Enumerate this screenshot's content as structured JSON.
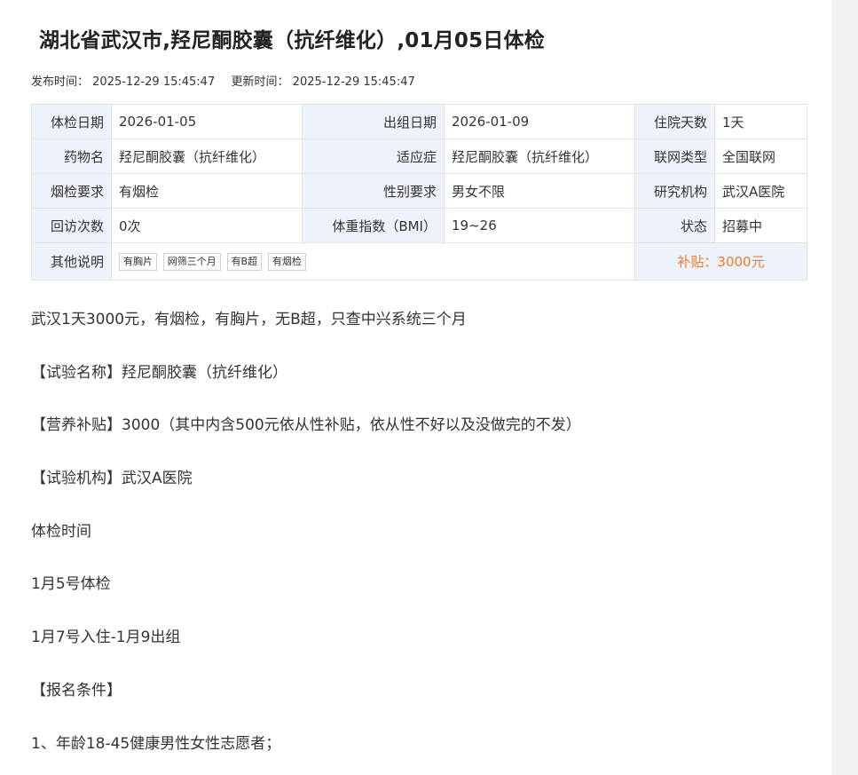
{
  "article": {
    "title": "湖北省武汉市,羟尼酮胶囊（抗纤维化）,01月05日体检",
    "published_label": "发布时间：",
    "published_time": "2025-12-29 15:45:47",
    "updated_label": "更新时间：",
    "updated_time": "2025-12-29 15:45:47"
  },
  "info": {
    "rows": [
      [
        {
          "label": "体检日期",
          "value": "2026-01-05"
        },
        {
          "label": "出组日期",
          "value": "2026-01-09"
        },
        {
          "label": "住院天数",
          "value": "1天"
        }
      ],
      [
        {
          "label": "药物名",
          "value": "羟尼酮胶囊（抗纤维化）"
        },
        {
          "label": "适应症",
          "value": "羟尼酮胶囊（抗纤维化）"
        },
        {
          "label": "联网类型",
          "value": "全国联网"
        }
      ],
      [
        {
          "label": "烟检要求",
          "value": "有烟检"
        },
        {
          "label": "性别要求",
          "value": "男女不限"
        },
        {
          "label": "研究机构",
          "value": "武汉A医院"
        }
      ],
      [
        {
          "label": "回访次数",
          "value": "0次"
        },
        {
          "label": "体重指数（BMI）",
          "value": "19~26"
        },
        {
          "label": "状态",
          "value": "招募中"
        }
      ]
    ],
    "other_label": "其他说明",
    "tags": [
      "有胸片",
      "网筛三个月",
      "有B超",
      "有烟检"
    ],
    "subsidy": "补贴：3000元",
    "subsidy_color": "#f07a2a"
  },
  "body": {
    "paragraphs": [
      "武汉1天3000元，有烟检，有胸片，无B超，只查中兴系统三个月",
      "【试验名称】羟尼酮胶囊（抗纤维化）",
      "【营养补贴】3000（其中内含500元依从性补贴，依从性不好以及没做完的不发）",
      "【试验机构】武汉A医院",
      "体检时间",
      "1月5号体检",
      "1月7号入住-1月9出组",
      "【报名条件】",
      "1、年龄18-45健康男性女性志愿者；"
    ]
  }
}
